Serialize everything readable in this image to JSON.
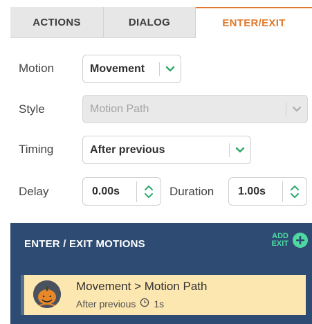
{
  "tabs": [
    {
      "label": "ACTIONS",
      "active": false
    },
    {
      "label": "DIALOG",
      "active": false
    },
    {
      "label": "ENTER/EXIT",
      "active": true
    }
  ],
  "fields": {
    "motion": {
      "label": "Motion",
      "value": "Movement"
    },
    "style": {
      "label": "Style",
      "value": "Motion Path",
      "disabled": true
    },
    "timing": {
      "label": "Timing",
      "value": "After previous"
    },
    "delay": {
      "label": "Delay",
      "value": "0.00s"
    },
    "duration": {
      "label": "Duration",
      "value": "1.00s"
    }
  },
  "motions": {
    "title": "ENTER / EXIT MOTIONS",
    "add_exit_line1": "ADD",
    "add_exit_line2": "EXIT",
    "items": [
      {
        "title": "Movement > Motion Path",
        "timing": "After previous",
        "duration": "1s"
      }
    ]
  },
  "colors": {
    "accent": "#e0792b",
    "chevron": "#2ea86b",
    "motions_bg": "#2d4b73",
    "add_green": "#4fd8a0",
    "item_bg": "#fde7b0"
  },
  "icons": [
    "chevron-down-icon",
    "stepper-icon",
    "plus-icon",
    "clock-icon",
    "pumpkin-avatar-icon"
  ]
}
